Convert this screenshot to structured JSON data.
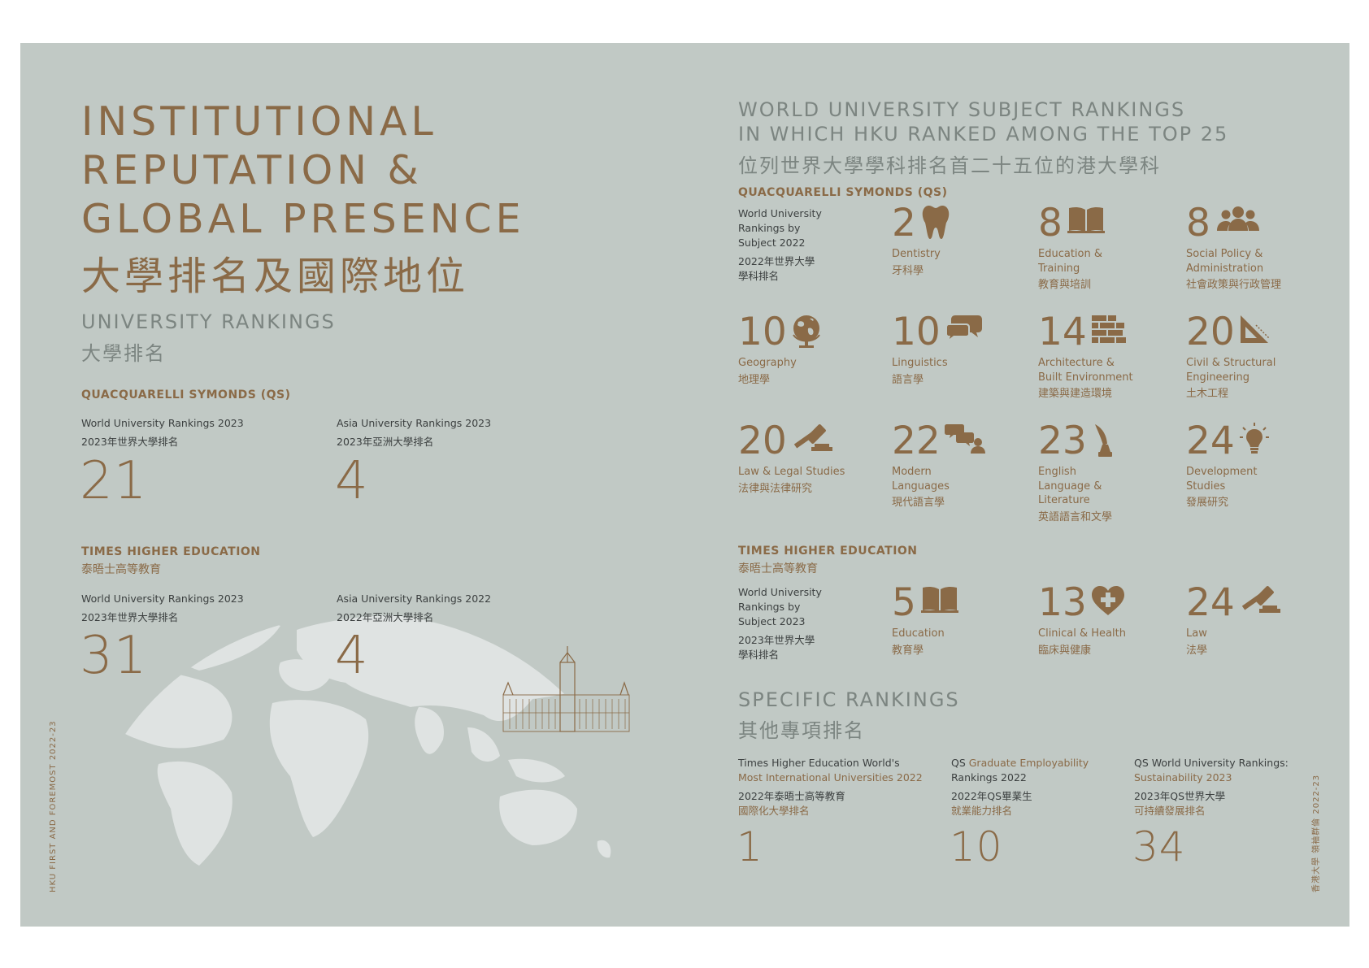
{
  "left": {
    "title_lines": [
      "INSTITUTIONAL",
      "REPUTATION &",
      "GLOBAL PRESENCE"
    ],
    "title_zh": "大學排名及國際地位",
    "section_en": "UNIVERSITY RANKINGS",
    "section_zh": "大學排名",
    "qs": {
      "org_en": "QUACQUARELLI SYMONDS (QS)",
      "world_en": "World University Rankings 2023",
      "world_zh": "2023年世界大學排名",
      "world_value": "21",
      "asia_en": "Asia University Rankings 2023",
      "asia_zh": "2023年亞洲大學排名",
      "asia_value": "4"
    },
    "the": {
      "org_en": "TIMES HIGHER EDUCATION",
      "org_zh": "泰晤士高等教育",
      "world_en": "World University Rankings 2023",
      "world_zh": "2023年世界大學排名",
      "world_value": "31",
      "asia_en": "Asia University Rankings 2022",
      "asia_zh": "2022年亞洲大學排名",
      "asia_value": "4"
    },
    "side_text": "HKU FIRST AND FOREMOST 2022-23"
  },
  "right": {
    "title_lines": [
      "WORLD UNIVERSITY SUBJECT RANKINGS",
      "IN WHICH HKU RANKED AMONG THE TOP 25"
    ],
    "title_zh": "位列世界大學學科排名首二十五位的港大學科",
    "qs": {
      "org_en": "QUACQUARELLI SYMONDS (QS)",
      "intro_en": [
        "World University",
        "Rankings by",
        "Subject 2022"
      ],
      "intro_zh": [
        "2022年世界大學",
        "學科排名"
      ],
      "subjects": [
        {
          "rank": "2",
          "en": [
            "Dentistry"
          ],
          "zh": "牙科學",
          "icon": "tooth-icon"
        },
        {
          "rank": "8",
          "en": [
            "Education &",
            "Training"
          ],
          "zh": "教育與培訓",
          "icon": "book-icon"
        },
        {
          "rank": "8",
          "en": [
            "Social Policy &",
            "Administration"
          ],
          "zh": "社會政策與行政管理",
          "icon": "people-icon"
        },
        {
          "rank": "10",
          "en": [
            "Geography"
          ],
          "zh": "地理學",
          "icon": "globe-icon"
        },
        {
          "rank": "10",
          "en": [
            "Linguistics"
          ],
          "zh": "語言學",
          "icon": "speech-bubbles-icon"
        },
        {
          "rank": "14",
          "en": [
            "Architecture &",
            "Built Environment"
          ],
          "zh": "建築與建造環境",
          "icon": "bricks-icon"
        },
        {
          "rank": "20",
          "en": [
            "Civil & Structural",
            "Engineering"
          ],
          "zh": "土木工程",
          "icon": "set-square-icon"
        },
        {
          "rank": "20",
          "en": [
            "Law & Legal Studies"
          ],
          "zh": "法律與法律研究",
          "icon": "gavel-icon"
        },
        {
          "rank": "22",
          "en": [
            "Modern",
            "Languages"
          ],
          "zh": "現代語言學",
          "icon": "chat-people-icon"
        },
        {
          "rank": "23",
          "en": [
            "English",
            "Language &",
            "Literature"
          ],
          "zh": "英語語言和文學",
          "icon": "quill-icon"
        },
        {
          "rank": "24",
          "en": [
            "Development",
            "Studies"
          ],
          "zh": "發展研究",
          "icon": "lightbulb-icon"
        }
      ]
    },
    "the": {
      "org_en": "TIMES HIGHER EDUCATION",
      "org_zh": "泰晤士高等教育",
      "intro_en": [
        "World University",
        "Rankings by",
        "Subject 2023"
      ],
      "intro_zh": [
        "2023年世界大學",
        "學科排名"
      ],
      "subjects": [
        {
          "rank": "5",
          "en": [
            "Education"
          ],
          "zh": "教育學",
          "icon": "book-icon"
        },
        {
          "rank": "13",
          "en": [
            "Clinical & Health"
          ],
          "zh": "臨床與健康",
          "icon": "heart-plus-icon"
        },
        {
          "rank": "24",
          "en": [
            "Law"
          ],
          "zh": "法學",
          "icon": "gavel-icon"
        }
      ]
    },
    "specific": {
      "title_en": "SPECIFIC RANKINGS",
      "title_zh": "其他專項排名",
      "items": [
        {
          "en_plain": "Times Higher Education World's",
          "en_gold": "Most International Universities 2022",
          "zh1": "2022年泰晤士高等教育",
          "zh2": "國際化大學排名",
          "value": "1"
        },
        {
          "en_plain": "QS ",
          "en_gold": "Graduate Employability",
          "en_plain2": "Rankings 2022",
          "zh1": "2022年QS畢業生",
          "zh2": "就業能力排名",
          "value": "10"
        },
        {
          "en_plain": "QS World University Rankings:",
          "en_gold": "Sustainability 2023",
          "zh1": "2023年QS世界大學",
          "zh2": "可持續發展排名",
          "value": "34"
        }
      ]
    },
    "side_text": "香港大學 領袖群倫 2022-23"
  },
  "colors": {
    "panel": "#c1c9c5",
    "accent": "#8a6a47",
    "muted": "#7c8581",
    "text": "#3c4040",
    "map": "#dfe3e2"
  }
}
